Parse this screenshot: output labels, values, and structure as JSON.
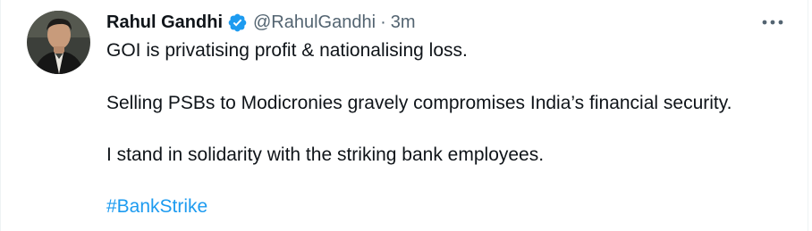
{
  "tweet": {
    "author": {
      "display_name": "Rahul Gandhi",
      "handle": "@RahulGandhi",
      "verified": true,
      "avatar_icon": "avatar-photo"
    },
    "separator": "·",
    "timestamp": "3m",
    "more_icon": "ellipsis-icon",
    "lines": [
      "GOI is privatising profit & nationalising loss.",
      "Selling PSBs to Modicronies gravely compromises India’s financial security.",
      "I stand in solidarity with the striking bank employees."
    ],
    "hashtag": "#BankStrike"
  },
  "colors": {
    "text": "#0f1419",
    "secondary": "#536471",
    "link": "#1d9bf0",
    "verified": "#1d9bf0"
  }
}
